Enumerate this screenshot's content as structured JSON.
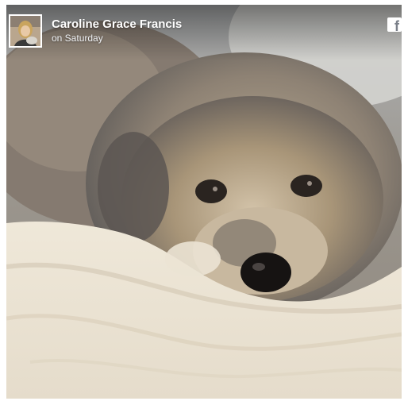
{
  "post": {
    "author_name": "Caroline Grace Francis",
    "timestamp": "on Saturday",
    "source_icon": "facebook-icon",
    "avatar_icon": "profile-avatar"
  },
  "photo": {
    "subject": "photo"
  },
  "colors": {
    "text_primary": "#ffffff",
    "text_secondary": "#eef0f3",
    "icon_bg": "#ffffff",
    "icon_fg": "#7a7f88"
  }
}
